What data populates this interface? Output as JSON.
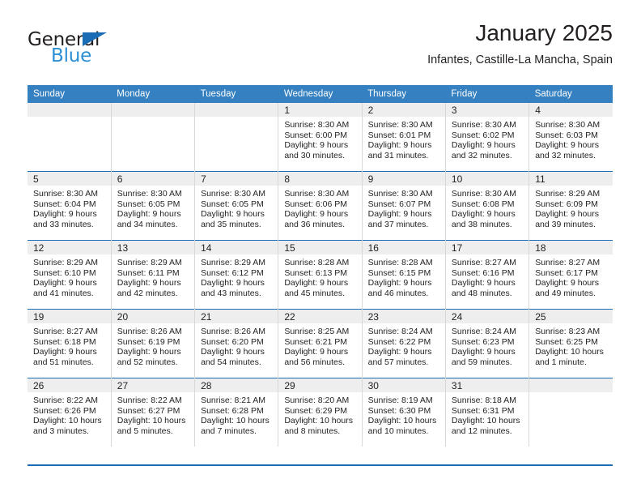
{
  "brand": {
    "logo_text_1": "General",
    "logo_text_2": "Blue",
    "logo_icon": "triangle-icon",
    "color_dark": "#231f20",
    "color_blue": "#2a8fd4",
    "color_header": "#3580c0",
    "color_rule": "#1a6cb5"
  },
  "header": {
    "title": "January 2025",
    "subtitle": "Infantes, Castille-La Mancha, Spain"
  },
  "calendar": {
    "weekday_headers": [
      "Sunday",
      "Monday",
      "Tuesday",
      "Wednesday",
      "Thursday",
      "Friday",
      "Saturday"
    ],
    "weeks": [
      [
        {
          "day": "",
          "empty": true
        },
        {
          "day": "",
          "empty": true
        },
        {
          "day": "",
          "empty": true
        },
        {
          "day": "1",
          "sunrise": "Sunrise: 8:30 AM",
          "sunset": "Sunset: 6:00 PM",
          "daylight_line1": "Daylight: 9 hours",
          "daylight_line2": "and 30 minutes."
        },
        {
          "day": "2",
          "sunrise": "Sunrise: 8:30 AM",
          "sunset": "Sunset: 6:01 PM",
          "daylight_line1": "Daylight: 9 hours",
          "daylight_line2": "and 31 minutes."
        },
        {
          "day": "3",
          "sunrise": "Sunrise: 8:30 AM",
          "sunset": "Sunset: 6:02 PM",
          "daylight_line1": "Daylight: 9 hours",
          "daylight_line2": "and 32 minutes."
        },
        {
          "day": "4",
          "sunrise": "Sunrise: 8:30 AM",
          "sunset": "Sunset: 6:03 PM",
          "daylight_line1": "Daylight: 9 hours",
          "daylight_line2": "and 32 minutes."
        }
      ],
      [
        {
          "day": "5",
          "sunrise": "Sunrise: 8:30 AM",
          "sunset": "Sunset: 6:04 PM",
          "daylight_line1": "Daylight: 9 hours",
          "daylight_line2": "and 33 minutes."
        },
        {
          "day": "6",
          "sunrise": "Sunrise: 8:30 AM",
          "sunset": "Sunset: 6:05 PM",
          "daylight_line1": "Daylight: 9 hours",
          "daylight_line2": "and 34 minutes."
        },
        {
          "day": "7",
          "sunrise": "Sunrise: 8:30 AM",
          "sunset": "Sunset: 6:05 PM",
          "daylight_line1": "Daylight: 9 hours",
          "daylight_line2": "and 35 minutes."
        },
        {
          "day": "8",
          "sunrise": "Sunrise: 8:30 AM",
          "sunset": "Sunset: 6:06 PM",
          "daylight_line1": "Daylight: 9 hours",
          "daylight_line2": "and 36 minutes."
        },
        {
          "day": "9",
          "sunrise": "Sunrise: 8:30 AM",
          "sunset": "Sunset: 6:07 PM",
          "daylight_line1": "Daylight: 9 hours",
          "daylight_line2": "and 37 minutes."
        },
        {
          "day": "10",
          "sunrise": "Sunrise: 8:30 AM",
          "sunset": "Sunset: 6:08 PM",
          "daylight_line1": "Daylight: 9 hours",
          "daylight_line2": "and 38 minutes."
        },
        {
          "day": "11",
          "sunrise": "Sunrise: 8:29 AM",
          "sunset": "Sunset: 6:09 PM",
          "daylight_line1": "Daylight: 9 hours",
          "daylight_line2": "and 39 minutes."
        }
      ],
      [
        {
          "day": "12",
          "sunrise": "Sunrise: 8:29 AM",
          "sunset": "Sunset: 6:10 PM",
          "daylight_line1": "Daylight: 9 hours",
          "daylight_line2": "and 41 minutes."
        },
        {
          "day": "13",
          "sunrise": "Sunrise: 8:29 AM",
          "sunset": "Sunset: 6:11 PM",
          "daylight_line1": "Daylight: 9 hours",
          "daylight_line2": "and 42 minutes."
        },
        {
          "day": "14",
          "sunrise": "Sunrise: 8:29 AM",
          "sunset": "Sunset: 6:12 PM",
          "daylight_line1": "Daylight: 9 hours",
          "daylight_line2": "and 43 minutes."
        },
        {
          "day": "15",
          "sunrise": "Sunrise: 8:28 AM",
          "sunset": "Sunset: 6:13 PM",
          "daylight_line1": "Daylight: 9 hours",
          "daylight_line2": "and 45 minutes."
        },
        {
          "day": "16",
          "sunrise": "Sunrise: 8:28 AM",
          "sunset": "Sunset: 6:15 PM",
          "daylight_line1": "Daylight: 9 hours",
          "daylight_line2": "and 46 minutes."
        },
        {
          "day": "17",
          "sunrise": "Sunrise: 8:27 AM",
          "sunset": "Sunset: 6:16 PM",
          "daylight_line1": "Daylight: 9 hours",
          "daylight_line2": "and 48 minutes."
        },
        {
          "day": "18",
          "sunrise": "Sunrise: 8:27 AM",
          "sunset": "Sunset: 6:17 PM",
          "daylight_line1": "Daylight: 9 hours",
          "daylight_line2": "and 49 minutes."
        }
      ],
      [
        {
          "day": "19",
          "sunrise": "Sunrise: 8:27 AM",
          "sunset": "Sunset: 6:18 PM",
          "daylight_line1": "Daylight: 9 hours",
          "daylight_line2": "and 51 minutes."
        },
        {
          "day": "20",
          "sunrise": "Sunrise: 8:26 AM",
          "sunset": "Sunset: 6:19 PM",
          "daylight_line1": "Daylight: 9 hours",
          "daylight_line2": "and 52 minutes."
        },
        {
          "day": "21",
          "sunrise": "Sunrise: 8:26 AM",
          "sunset": "Sunset: 6:20 PM",
          "daylight_line1": "Daylight: 9 hours",
          "daylight_line2": "and 54 minutes."
        },
        {
          "day": "22",
          "sunrise": "Sunrise: 8:25 AM",
          "sunset": "Sunset: 6:21 PM",
          "daylight_line1": "Daylight: 9 hours",
          "daylight_line2": "and 56 minutes."
        },
        {
          "day": "23",
          "sunrise": "Sunrise: 8:24 AM",
          "sunset": "Sunset: 6:22 PM",
          "daylight_line1": "Daylight: 9 hours",
          "daylight_line2": "and 57 minutes."
        },
        {
          "day": "24",
          "sunrise": "Sunrise: 8:24 AM",
          "sunset": "Sunset: 6:23 PM",
          "daylight_line1": "Daylight: 9 hours",
          "daylight_line2": "and 59 minutes."
        },
        {
          "day": "25",
          "sunrise": "Sunrise: 8:23 AM",
          "sunset": "Sunset: 6:25 PM",
          "daylight_line1": "Daylight: 10 hours",
          "daylight_line2": "and 1 minute."
        }
      ],
      [
        {
          "day": "26",
          "sunrise": "Sunrise: 8:22 AM",
          "sunset": "Sunset: 6:26 PM",
          "daylight_line1": "Daylight: 10 hours",
          "daylight_line2": "and 3 minutes."
        },
        {
          "day": "27",
          "sunrise": "Sunrise: 8:22 AM",
          "sunset": "Sunset: 6:27 PM",
          "daylight_line1": "Daylight: 10 hours",
          "daylight_line2": "and 5 minutes."
        },
        {
          "day": "28",
          "sunrise": "Sunrise: 8:21 AM",
          "sunset": "Sunset: 6:28 PM",
          "daylight_line1": "Daylight: 10 hours",
          "daylight_line2": "and 7 minutes."
        },
        {
          "day": "29",
          "sunrise": "Sunrise: 8:20 AM",
          "sunset": "Sunset: 6:29 PM",
          "daylight_line1": "Daylight: 10 hours",
          "daylight_line2": "and 8 minutes."
        },
        {
          "day": "30",
          "sunrise": "Sunrise: 8:19 AM",
          "sunset": "Sunset: 6:30 PM",
          "daylight_line1": "Daylight: 10 hours",
          "daylight_line2": "and 10 minutes."
        },
        {
          "day": "31",
          "sunrise": "Sunrise: 8:18 AM",
          "sunset": "Sunset: 6:31 PM",
          "daylight_line1": "Daylight: 10 hours",
          "daylight_line2": "and 12 minutes."
        },
        {
          "day": "",
          "empty": true
        }
      ]
    ]
  }
}
